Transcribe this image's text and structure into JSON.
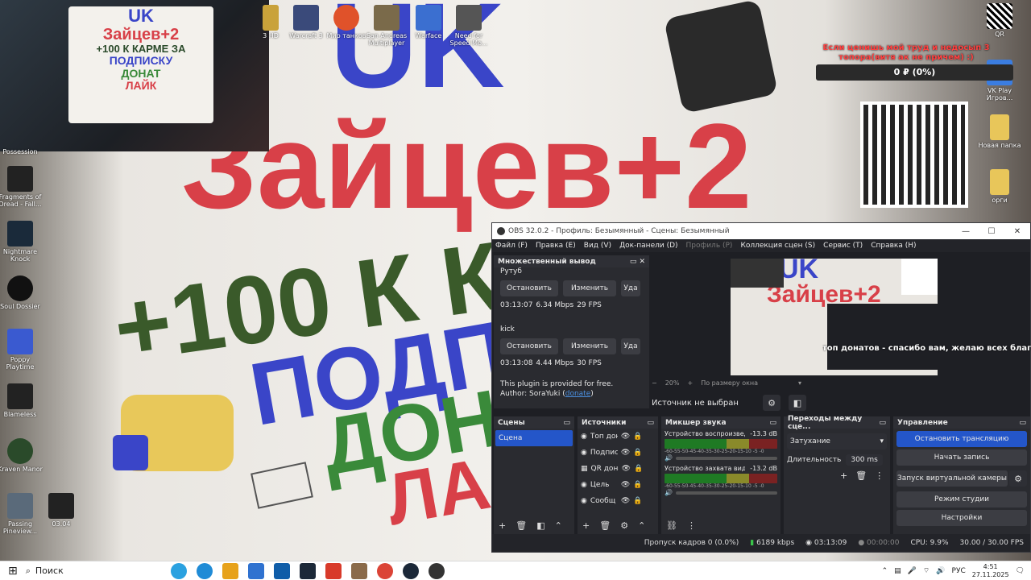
{
  "webcam": {
    "sign": {
      "line1": "UK",
      "line2": "Зайцев+2",
      "line3": "+100 К КАРМЕ ЗА",
      "line4": "ПОДПИСКУ",
      "line5": "ДОНАТ",
      "line6": "ЛАЙК"
    }
  },
  "wall_sign": {
    "line1": "UK",
    "line2": "Зайцев+2",
    "line3": "+100 К КА",
    "line4": "ПОДП",
    "line5": "ДОН",
    "line6": "ЛА"
  },
  "desktop_icons_top": [
    {
      "label": "3 HD",
      "color": "#c9a23a"
    },
    {
      "label": "Warcraft 3",
      "color": "#3a4a7a"
    },
    {
      "label": "Мир танков",
      "color": "#e0522a"
    },
    {
      "label": "San Andreas Multiplayer",
      "color": "#7a6a4a"
    },
    {
      "label": "Warface",
      "color": "#3b6fd0"
    },
    {
      "label": "Need for Speed Mo...",
      "color": "#555555"
    }
  ],
  "desktop_icons_left": [
    {
      "label": "Possession",
      "color": "#333333"
    },
    {
      "label": "Fragments of Dread - Fall...",
      "color": "#222222"
    },
    {
      "label": "Nightmare Knock",
      "color": "#1a2a3a"
    },
    {
      "label": "Soul Dossier",
      "color": "#111111"
    },
    {
      "label": "Poppy Playtime",
      "color": "#3a5ad0"
    },
    {
      "label": "Blameless",
      "color": "#222222"
    },
    {
      "label": "Kraven Manor",
      "color": "#2a4a2a"
    },
    {
      "label": "Passing Pineview...",
      "color": "#5a6a7a"
    }
  ],
  "desktop_icon_0304": {
    "label": "03.04",
    "color": "#222222"
  },
  "desktop_icons_right": [
    {
      "label": "QR",
      "color": "#ffffff"
    },
    {
      "label": "VK Play Игров...",
      "color": "#3b7de0"
    },
    {
      "label": "Новая папка",
      "color": "#e8c65a"
    },
    {
      "label": "орги",
      "color": "#e8c65a"
    }
  ],
  "overlay": {
    "donation_text": "Если ценишь мой труд и недосып 3 топора(витя ак не причем) :)",
    "goal_value": "0 ₽ (0%)",
    "marquee": "топ донатов - спасибо вам, желаю всех благ!"
  },
  "obs": {
    "title": "OBS 32.0.2 - Профиль: Безымянный - Сцены: Безымянный",
    "window_buttons": [
      "—",
      "☐",
      "✕"
    ],
    "menu": [
      "Файл (F)",
      "Правка (E)",
      "Вид (V)",
      "Док-панели (D)",
      "Профиль (P)",
      "Коллекция сцен (S)",
      "Сервис (T)",
      "Справка (H)"
    ],
    "multi_output": {
      "title": "Множественный вывод",
      "targets": [
        {
          "name": "Рутуб",
          "stop": "Остановить",
          "edit": "Изменить",
          "extra": "Уда",
          "time": "03:13:07",
          "bitrate": "6.34 Mbps",
          "fps": "29 FPS"
        },
        {
          "name": "kick",
          "stop": "Остановить",
          "edit": "Изменить",
          "extra": "Уда",
          "time": "03:13:08",
          "bitrate": "4.44 Mbps",
          "fps": "30 FPS"
        }
      ],
      "free_text": "This plugin is provided for free.",
      "author_prefix": "Author: SoraYuki (",
      "author_link": "donate",
      "author_suffix": ")"
    },
    "zoom": {
      "minus": "−",
      "value": "20%",
      "plus": "+",
      "fit": "По размеру окна"
    },
    "no_source": "Источник не выбран",
    "scenes": {
      "title": "Сцены",
      "items": [
        "Сцена"
      ]
    },
    "sources": {
      "title": "Источники",
      "items": [
        "Топ дон",
        "Подпис",
        "QR дона",
        "Цель",
        "Сообщ"
      ]
    },
    "mixer": {
      "title": "Микшер звука",
      "channels": [
        {
          "name": "Устройство воспроизведе",
          "db": "-13.3 dB"
        },
        {
          "name": "Устройство захвата видео",
          "db": "-13.2 dB"
        }
      ],
      "scale": "-60-55-50-45-40-35-30-25-20-15-10 -5 -0"
    },
    "transitions": {
      "title": "Переходы между сце...",
      "selected": "Затухание",
      "duration_label": "Длительность",
      "duration_value": "300 ms"
    },
    "controls": {
      "title": "Управление",
      "buttons": [
        "Остановить трансляцию",
        "Начать запись",
        "Запуск виртуальной камеры",
        "Режим студии",
        "Настройки"
      ]
    },
    "status": {
      "dropped": "Пропуск кадров 0 (0.0%)",
      "kbps": "6189 kbps",
      "stream_time": "03:13:09",
      "rec_time": "00:00:00",
      "cpu": "CPU: 9.9%",
      "fps": "30.00 / 30.00 FPS"
    }
  },
  "taskbar": {
    "search_placeholder": "Поиск",
    "apps": [
      "#2aa1e0",
      "#1f8bd6",
      "#e7a21b",
      "#2f72d0",
      "#0f5da8",
      "#1b2838",
      "#d83a2a",
      "#8a6a4a",
      "#db4437",
      "#1b2838",
      "#333333"
    ],
    "lang": "РУС",
    "time": "4:51",
    "date": "27.11.2025"
  }
}
